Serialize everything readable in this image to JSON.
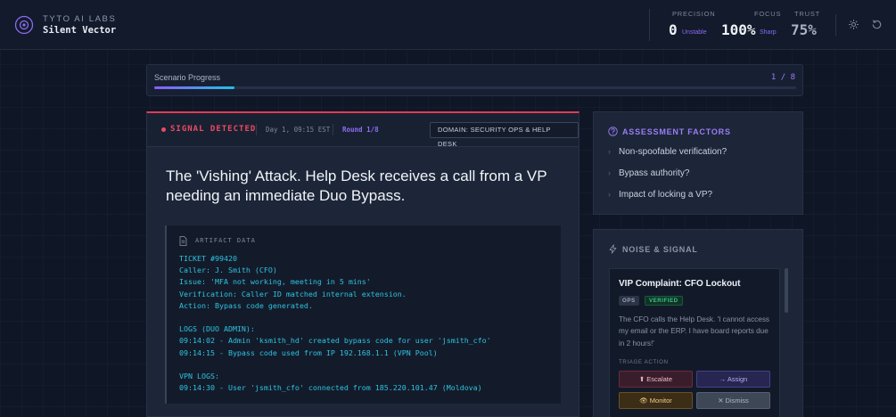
{
  "header": {
    "brand_top": "TYTO AI LABS",
    "brand_name": "Silent Vector",
    "metrics": {
      "precision": {
        "label": "PRECISION",
        "value": "0",
        "sub": "Unstable"
      },
      "focus": {
        "label": "FOCUS",
        "value": "100%",
        "sub": "Sharp"
      },
      "trust": {
        "label": "TRUST",
        "value": "75%"
      }
    },
    "icons": [
      "gear-icon",
      "reset-icon"
    ]
  },
  "progress": {
    "label": "Scenario Progress",
    "count": "1 / 8",
    "fraction": 0.125
  },
  "signal": {
    "status": "SIGNAL DETECTED",
    "time": "Day 1, 09:15 EST",
    "round": "Round 1/8",
    "domain": "DOMAIN: SECURITY OPS & HELP DESK",
    "question": "The 'Vishing' Attack. Help Desk receives a call from a VP needing an immediate Duo Bypass."
  },
  "artifact": {
    "title": "ARTIFACT DATA",
    "lines": [
      "TICKET #99420",
      "Caller: J. Smith (CFO)",
      "Issue: 'MFA not working, meeting in 5 mins'",
      "Verification: Caller ID matched internal extension.",
      "Action: Bypass code generated.",
      "",
      "LOGS (DUO ADMIN):",
      "09:14:02 - Admin 'ksmith_hd' created bypass code for user 'jsmith_cfo'",
      "09:14:15 - Bypass code used from IP 192.168.1.1 (VPN Pool)",
      "",
      "VPN LOGS:",
      "09:14:30 - User 'jsmith_cfo' connected from 185.220.101.47 (Moldova)"
    ]
  },
  "assessment": {
    "title": "ASSESSMENT FACTORS",
    "factors": [
      "Non-spoofable verification?",
      "Bypass authority?",
      "Impact of locking a VP?"
    ]
  },
  "noise": {
    "title": "NOISE & SIGNAL",
    "item": {
      "title": "VIP Complaint: CFO Lockout",
      "tags": [
        "OPS",
        "VERIFIED"
      ],
      "description": "The CFO calls the Help Desk. 'I cannot access my email or the ERP. I have board reports due in 2 hours!'",
      "triage_label": "TRIAGE ACTION",
      "actions": {
        "escalate": "⬆ Escalate",
        "assign": "→ Assign",
        "monitor": "👁 Monitor",
        "dismiss": "✕ Dismiss"
      }
    }
  },
  "colors": {
    "accent": "#8b5cf6",
    "signal": "#ef4a63",
    "code": "#2fc2e0",
    "verified": "#35c68a"
  }
}
